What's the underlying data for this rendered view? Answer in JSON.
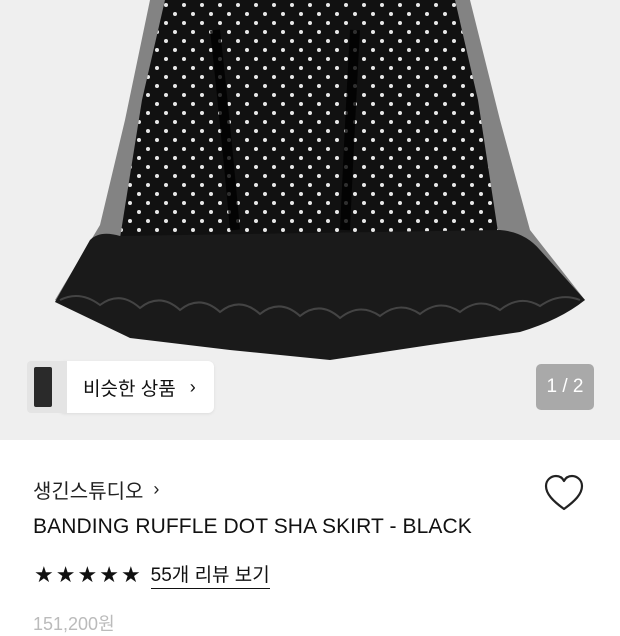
{
  "hero": {
    "similar_products_label": "비슷한 상품",
    "page_counter": "1 / 2"
  },
  "product": {
    "brand": "생긴스튜디오",
    "title": "BANDING RUFFLE DOT SHA SKIRT - BLACK",
    "rating_stars": 5,
    "reviews_link": "55개 리뷰 보기",
    "price": "151,200원"
  },
  "icons": {
    "similar_chevron": "chevron-right-icon",
    "brand_chevron": "chevron-right-icon",
    "wishlist": "heart-outline-icon",
    "star": "star-filled-icon"
  },
  "colors": {
    "hero_bg": "#efefef",
    "counter_bg": "#a9a9a9",
    "text": "#111111"
  }
}
